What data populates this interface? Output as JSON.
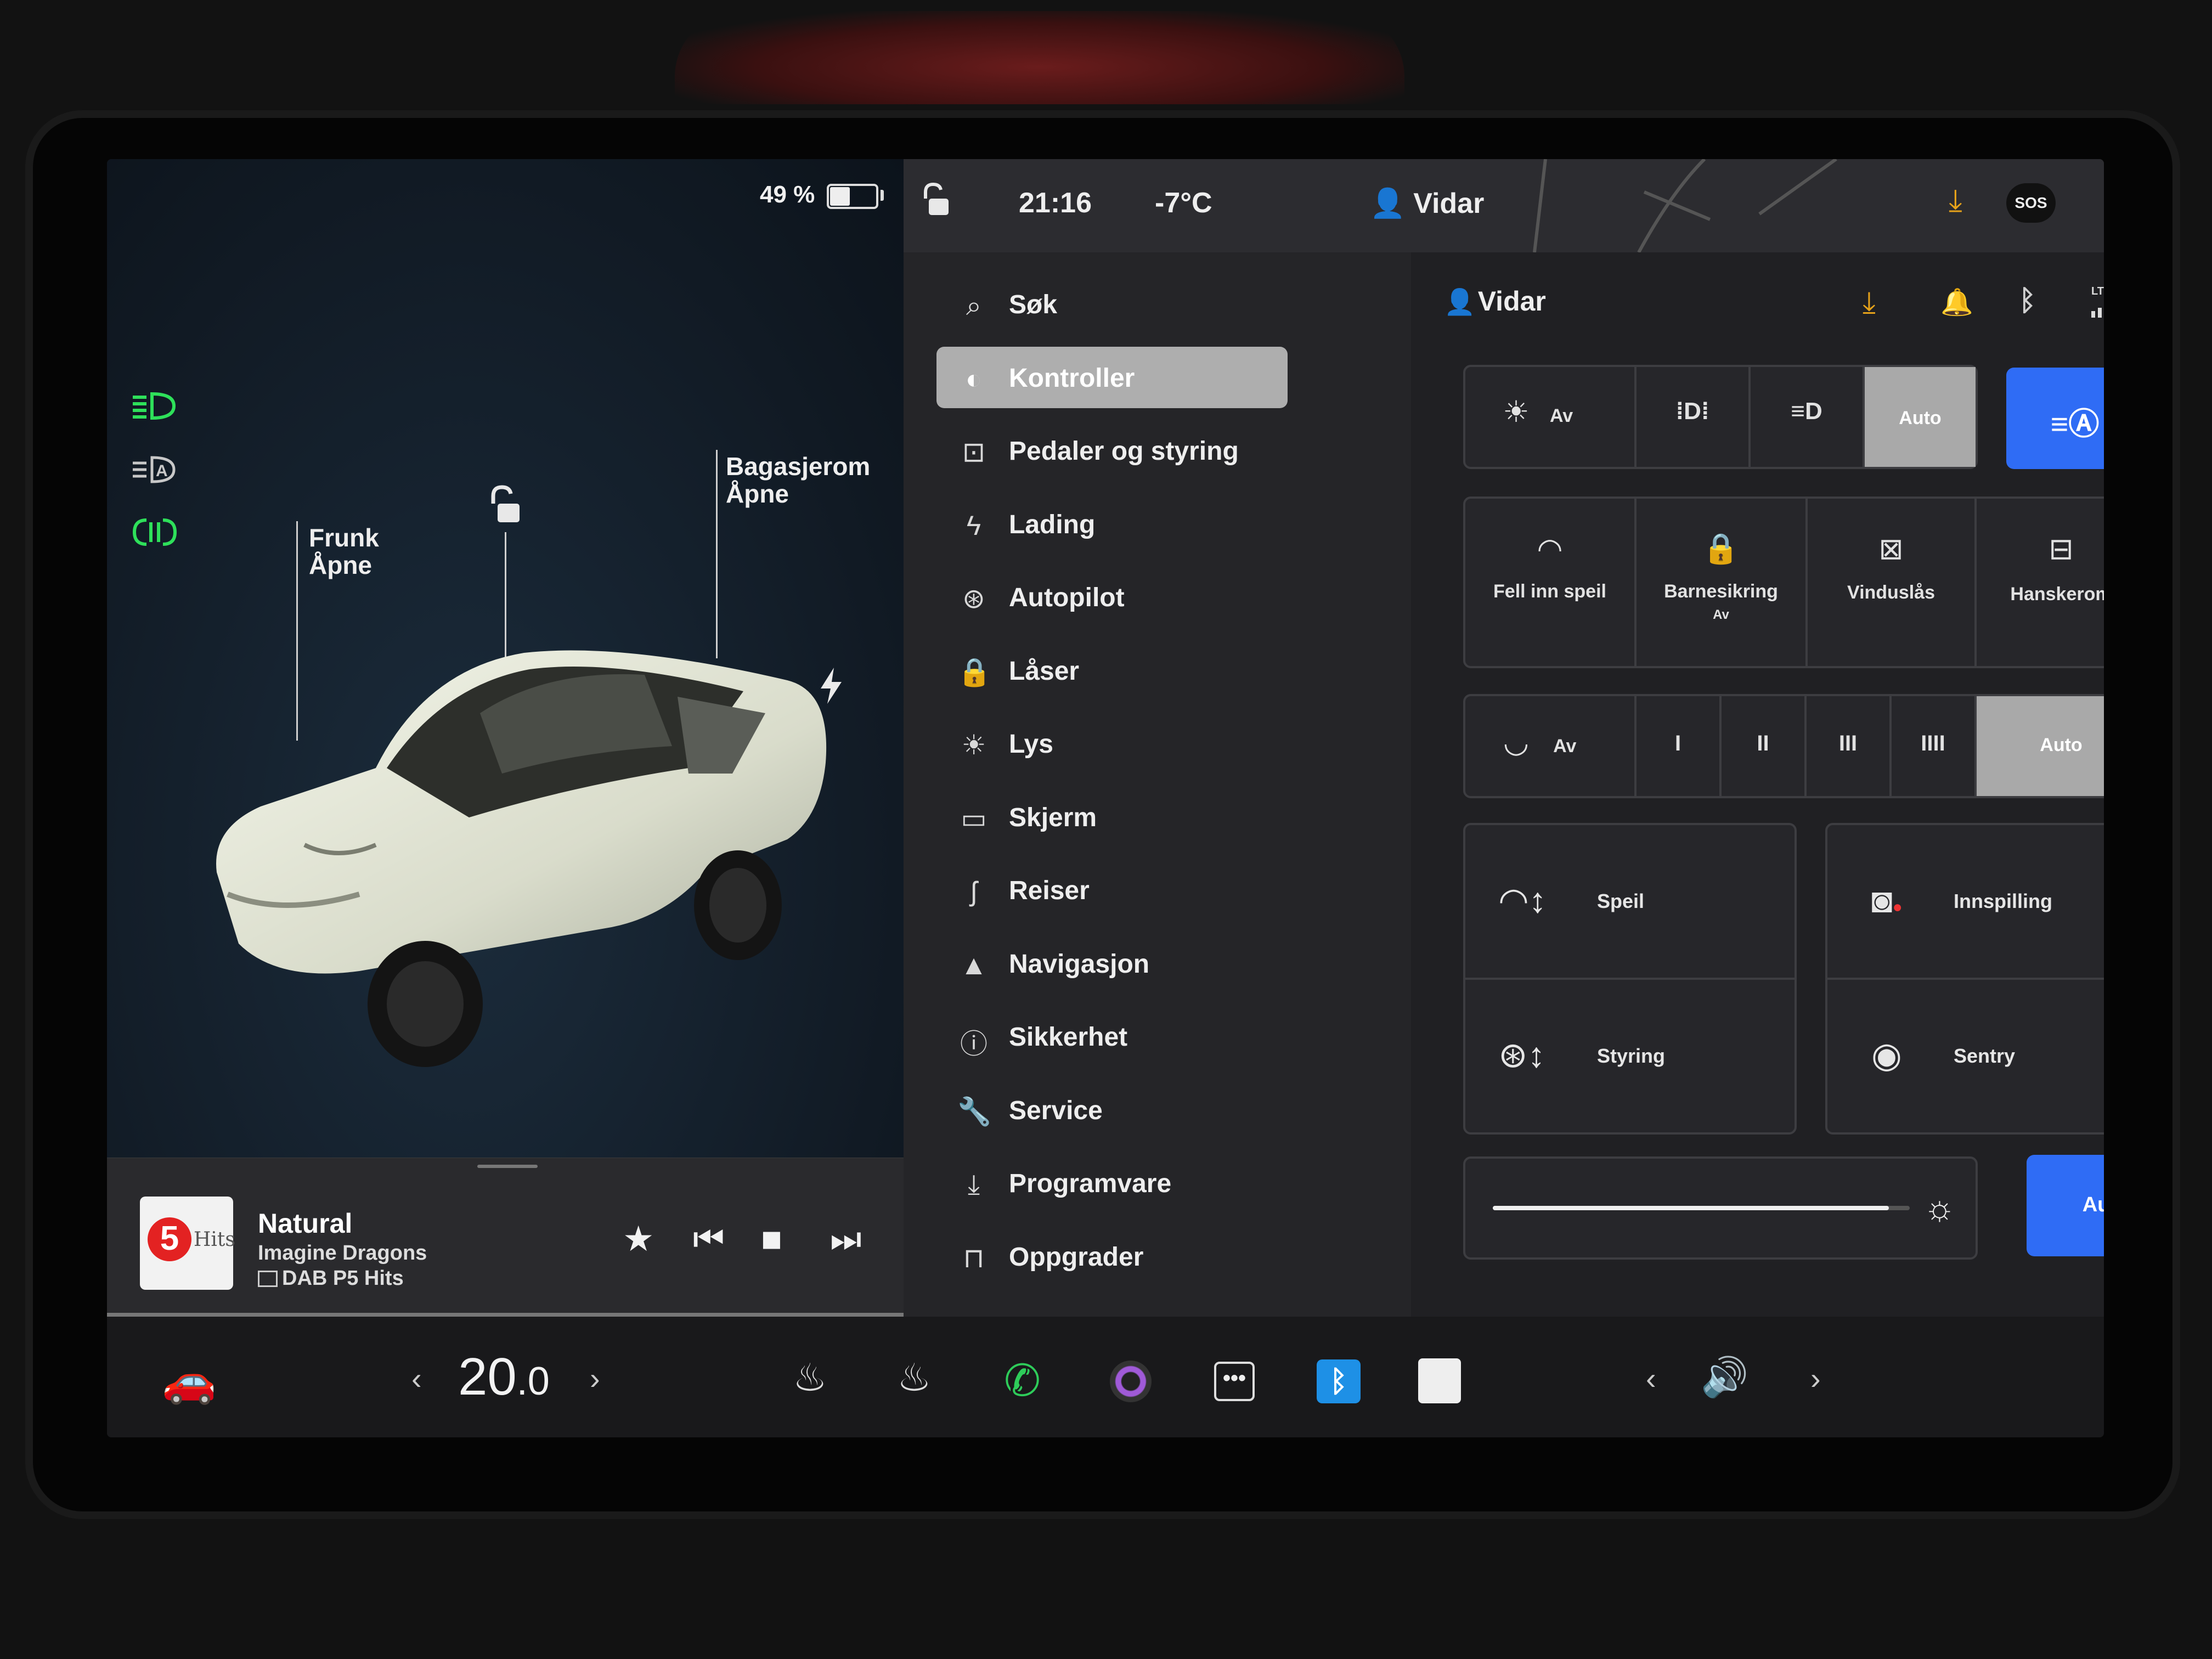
{
  "car_panel": {
    "battery_percent": "49 %",
    "battery_level": 0.49,
    "light_indicators": [
      "headlight-on-icon",
      "auto-highbeam-icon",
      "fog-light-icon"
    ],
    "callouts": {
      "frunk_title": "Frunk",
      "frunk_state": "Åpne",
      "trunk_title": "Bagasjerom",
      "trunk_state": "Åpne"
    },
    "lock_icon": "unlock-icon",
    "charge_icon": "lightning-icon"
  },
  "status_bar": {
    "lock_icon": "unlock-icon",
    "time": "21:16",
    "temperature": "-7°C",
    "user": "Vidar",
    "sos": "SOS"
  },
  "menu": {
    "items": [
      {
        "label": "Søk",
        "icon": "search-icon"
      },
      {
        "label": "Kontroller",
        "icon": "toggle-icon",
        "active": true
      },
      {
        "label": "Pedaler og styring",
        "icon": "car-icon"
      },
      {
        "label": "Lading",
        "icon": "lightning-icon"
      },
      {
        "label": "Autopilot",
        "icon": "steering-wheel-icon"
      },
      {
        "label": "Låser",
        "icon": "lock-icon"
      },
      {
        "label": "Lys",
        "icon": "sun-icon"
      },
      {
        "label": "Skjerm",
        "icon": "display-icon"
      },
      {
        "label": "Reiser",
        "icon": "trips-icon"
      },
      {
        "label": "Navigasjon",
        "icon": "navigation-icon"
      },
      {
        "label": "Sikkerhet",
        "icon": "safety-icon"
      },
      {
        "label": "Service",
        "icon": "wrench-icon"
      },
      {
        "label": "Programvare",
        "icon": "download-icon"
      },
      {
        "label": "Oppgrader",
        "icon": "bag-icon"
      }
    ]
  },
  "controls": {
    "header_user": "Vidar",
    "header_icons": [
      "download-icon",
      "bell-icon",
      "bluetooth-icon",
      "lte-signal-icon"
    ],
    "lte": "LTE",
    "lights": {
      "off_label": "Av",
      "auto_label": "Auto",
      "selected": "Auto"
    },
    "quick": {
      "fold_mirrors": "Fell inn speil",
      "child_lock": "Barnesikring",
      "child_lock_state": "Av",
      "window_lock": "Vinduslås",
      "glovebox": "Hanskerom"
    },
    "wipers": {
      "off_label": "Av",
      "speeds": [
        "I",
        "II",
        "III",
        "IIII"
      ],
      "auto_label": "Auto",
      "selected": "Auto"
    },
    "adjust": {
      "mirrors": "Speil",
      "steering": "Styring",
      "recording": "Innspilling",
      "sentry": "Sentry"
    },
    "brightness": {
      "level": 0.95,
      "auto_label": "Auto"
    }
  },
  "media": {
    "song": "Natural",
    "artist": "Imagine Dragons",
    "station": "DAB P5 Hits",
    "album_number": "5",
    "album_text": "Hits"
  },
  "dock": {
    "temperature_whole": "20",
    "temperature_decimal": ".0",
    "apps": [
      "defrost-icon",
      "seat-heater-icon",
      "phone-icon",
      "camera-icon",
      "more-icon",
      "bluetooth-icon",
      "notes-icon"
    ]
  }
}
